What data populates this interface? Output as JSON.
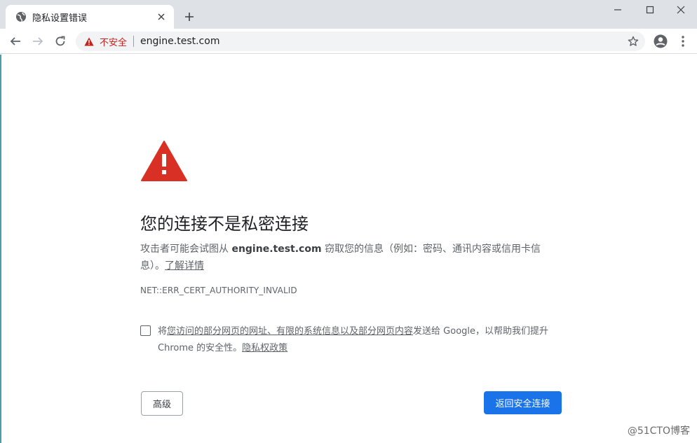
{
  "tab": {
    "title": "隐私设置错误",
    "favicon": "globe-icon"
  },
  "toolbar": {
    "security_label": "不安全",
    "url": "engine.test.com"
  },
  "page": {
    "heading": "您的连接不是私密连接",
    "desc_before": "攻击者可能会试图从 ",
    "desc_host": "engine.test.com",
    "desc_after": " 窃取您的信息（例如：密码、通讯内容或信用卡信息）。",
    "learn_more": "了解详情",
    "error_code": "NET::ERR_CERT_AUTHORITY_INVALID",
    "optin_before": "将",
    "optin_link1": "您访问的部分网页的网址、有限的系统信息以及部分网页内容",
    "optin_after": "发送给 Google，以帮助我们提升 Chrome 的安全性。",
    "optin_link2": "隐私权政策",
    "advanced_button": "高级",
    "back_button": "返回安全连接"
  },
  "watermark": "@51CTO博客",
  "colors": {
    "accent": "#1a73e8",
    "danger": "#d93025",
    "insecure_text": "#c5221f"
  }
}
